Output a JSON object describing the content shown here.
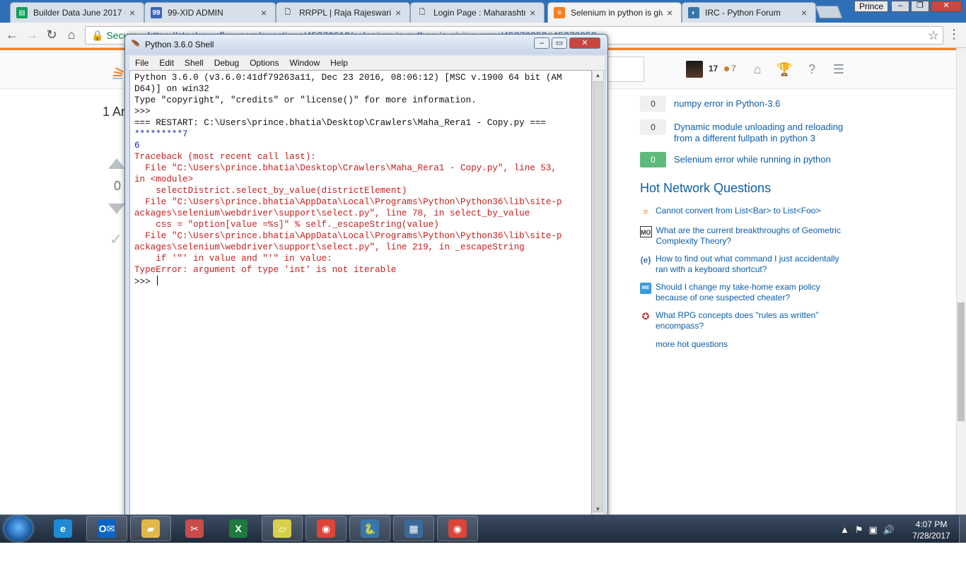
{
  "browser": {
    "tabs": [
      {
        "title": "Builder Data June 2017 -",
        "icon": "sheets-icon",
        "color": "#0f9d58",
        "glyph": "▤"
      },
      {
        "title": "99-XID ADMIN",
        "icon": "page-icon",
        "color": "#3b63b8",
        "glyph": "99"
      },
      {
        "title": "RRPPL | Raja Rajeswari p",
        "icon": "document-icon",
        "color": "#9aa",
        "glyph": "🗋"
      },
      {
        "title": "Login Page : Maharashtr",
        "icon": "document-icon",
        "color": "#9aa",
        "glyph": "🗋"
      },
      {
        "title": "Selenium in python is giv",
        "icon": "stackoverflow-icon",
        "color": "#f48024",
        "glyph": "≡"
      },
      {
        "title": "IRC - Python Forum",
        "icon": "python-forum-icon",
        "color": "#3776ab",
        "glyph": "◐"
      }
    ],
    "profile": "Prince",
    "address": {
      "secure_label": "Secure",
      "url": "https://stackoverflow.com/questions/45370612/selenium-in-python-is-giving-error/45370952#45370952"
    }
  },
  "stackoverflow": {
    "reputation": "17",
    "bronze": "7",
    "answers_count": "1 Ar",
    "vote_count": "0",
    "related": [
      {
        "score": "0",
        "title": "numpy error in Python-3.6",
        "answered": false
      },
      {
        "score": "0",
        "title": "Dynamic module unloading and reloading from a different fullpath in python 3",
        "answered": false
      },
      {
        "score": "0",
        "title": "Selenium error while running in python",
        "answered": true
      }
    ],
    "hot_network_title": "Hot Network Questions",
    "hot_network": [
      {
        "title": "Cannot convert from List<Bar> to List<Foo>",
        "icon": "stackoverflow-icon",
        "glyph": "≡",
        "color": "#f48024"
      },
      {
        "title": "What are the current breakthroughs of Geometric Complexity Theory?",
        "icon": "mathoverflow-icon",
        "glyph": "MO",
        "color": "#333"
      },
      {
        "title": "How to find out what command I just accidentally ran with a keyboard shortcut?",
        "icon": "emacs-icon",
        "glyph": "(e)",
        "color": "#3a6fb8"
      },
      {
        "title": "Should I change my take-home exam policy because of one suspected cheater?",
        "icon": "academia-icon",
        "glyph": "ME",
        "color": "#3a9ad9"
      },
      {
        "title": "What RPG concepts does \"rules as written\" encompass?",
        "icon": "rpg-icon",
        "glyph": "✪",
        "color": "#b23a3a"
      }
    ],
    "more_hot": "more hot questions"
  },
  "idle": {
    "title": "Python 3.6.0 Shell",
    "menu": [
      "File",
      "Edit",
      "Shell",
      "Debug",
      "Options",
      "Window",
      "Help"
    ],
    "lines": [
      {
        "t": "Python 3.6.0 (v3.6.0:41df79263a11, Dec 23 2016, 08:06:12) [MSC v.1900 64 bit (AM",
        "c": "normal"
      },
      {
        "t": "D64)] on win32",
        "c": "normal"
      },
      {
        "t": "Type \"copyright\", \"credits\" or \"license()\" for more information.",
        "c": "normal"
      },
      {
        "t": ">>> ",
        "c": "normal"
      },
      {
        "t": "=== RESTART: C:\\Users\\prince.bhatia\\Desktop\\Crawlers\\Maha_Rera1 - Copy.py ===",
        "c": "normal"
      },
      {
        "t": "*********7",
        "c": "blue"
      },
      {
        "t": "6",
        "c": "blue"
      },
      {
        "t": "Traceback (most recent call last):",
        "c": "red"
      },
      {
        "t": "  File \"C:\\Users\\prince.bhatia\\Desktop\\Crawlers\\Maha_Rera1 - Copy.py\", line 53,",
        "c": "red"
      },
      {
        "t": "in <module>",
        "c": "red"
      },
      {
        "t": "    selectDistrict.select_by_value(districtElement)",
        "c": "red"
      },
      {
        "t": "  File \"C:\\Users\\prince.bhatia\\AppData\\Local\\Programs\\Python\\Python36\\lib\\site-p",
        "c": "red"
      },
      {
        "t": "ackages\\selenium\\webdriver\\support\\select.py\", line 78, in select_by_value",
        "c": "red"
      },
      {
        "t": "    css = \"option[value =%s]\" % self._escapeString(value)",
        "c": "red"
      },
      {
        "t": "  File \"C:\\Users\\prince.bhatia\\AppData\\Local\\Programs\\Python\\Python36\\lib\\site-p",
        "c": "red"
      },
      {
        "t": "ackages\\selenium\\webdriver\\support\\select.py\", line 219, in _escapeString",
        "c": "red"
      },
      {
        "t": "    if '\"' in value and \"'\" in value:",
        "c": "red"
      },
      {
        "t": "TypeError: argument of type 'int' is not iterable",
        "c": "red"
      },
      {
        "t": ">>> ",
        "c": "normal",
        "caret": true
      }
    ]
  },
  "taskbar": {
    "apps": [
      {
        "name": "internet-explorer-icon",
        "glyph": "e",
        "color": "#1f8ad6",
        "active": false
      },
      {
        "name": "outlook-icon",
        "glyph": "O✉",
        "color": "#0a64c2",
        "active": true
      },
      {
        "name": "file-explorer-icon",
        "glyph": "▰",
        "color": "#e0b84a",
        "active": true
      },
      {
        "name": "snipping-tool-icon",
        "glyph": "✂",
        "color": "#c94c4c",
        "active": false
      },
      {
        "name": "excel-icon",
        "glyph": "X",
        "color": "#1e7a3e",
        "active": false
      },
      {
        "name": "sticky-notes-icon",
        "glyph": "▱",
        "color": "#d8d04a",
        "active": true
      },
      {
        "name": "chrome-icon",
        "glyph": "◉",
        "color": "#db4437",
        "active": true
      },
      {
        "name": "python-icon",
        "glyph": "🐍",
        "color": "#3776ab",
        "active": true
      },
      {
        "name": "window-app-icon",
        "glyph": "▦",
        "color": "#3a6a9a",
        "active": true
      },
      {
        "name": "chrome-icon-2",
        "glyph": "◉",
        "color": "#db4437",
        "active": true
      }
    ],
    "time": "4:07 PM",
    "date": "7/28/2017"
  }
}
